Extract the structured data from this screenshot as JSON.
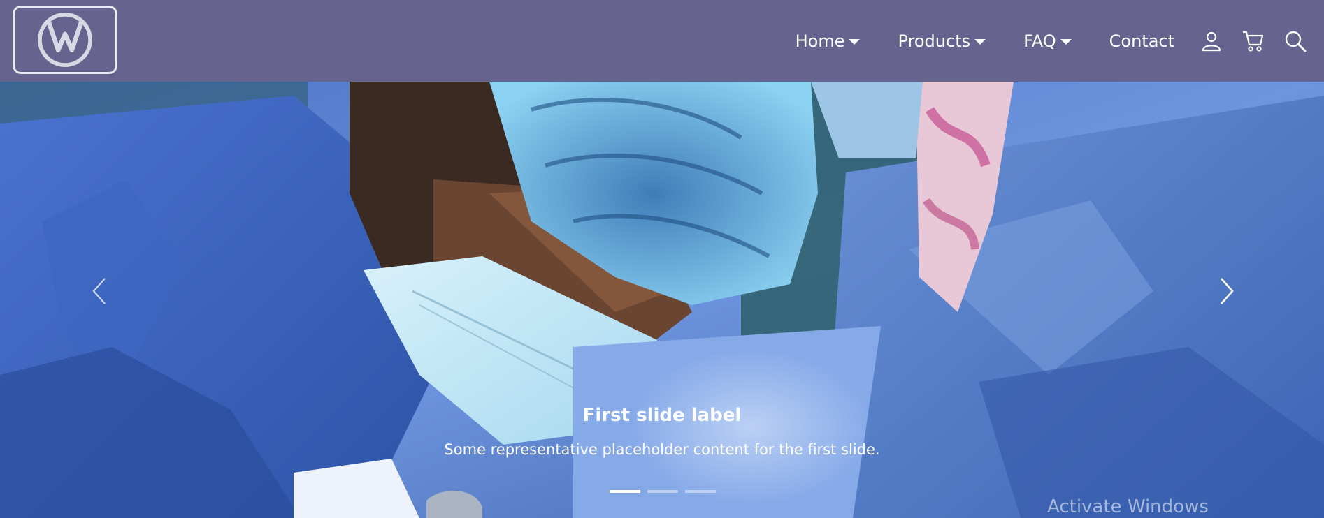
{
  "brand": {
    "logo_name": "volkswagen-logo",
    "border_color": "#e9e9f2"
  },
  "nav": {
    "background": "#66638f",
    "items": [
      {
        "label": "Home",
        "has_dropdown": true
      },
      {
        "label": "Products",
        "has_dropdown": true
      },
      {
        "label": "FAQ",
        "has_dropdown": true
      },
      {
        "label": "Contact",
        "has_dropdown": false
      }
    ],
    "icons": [
      "user-icon",
      "cart-icon",
      "search-icon"
    ]
  },
  "carousel": {
    "slide_image_subject": "surgeon-in-blue-scrubs",
    "caption_title": "First slide label",
    "caption_text": "Some representative placeholder content for the first slide.",
    "slide_count": 3,
    "active_index": 0,
    "controls": [
      "previous",
      "next"
    ]
  },
  "os_overlay": {
    "watermark": "Activate Windows"
  }
}
